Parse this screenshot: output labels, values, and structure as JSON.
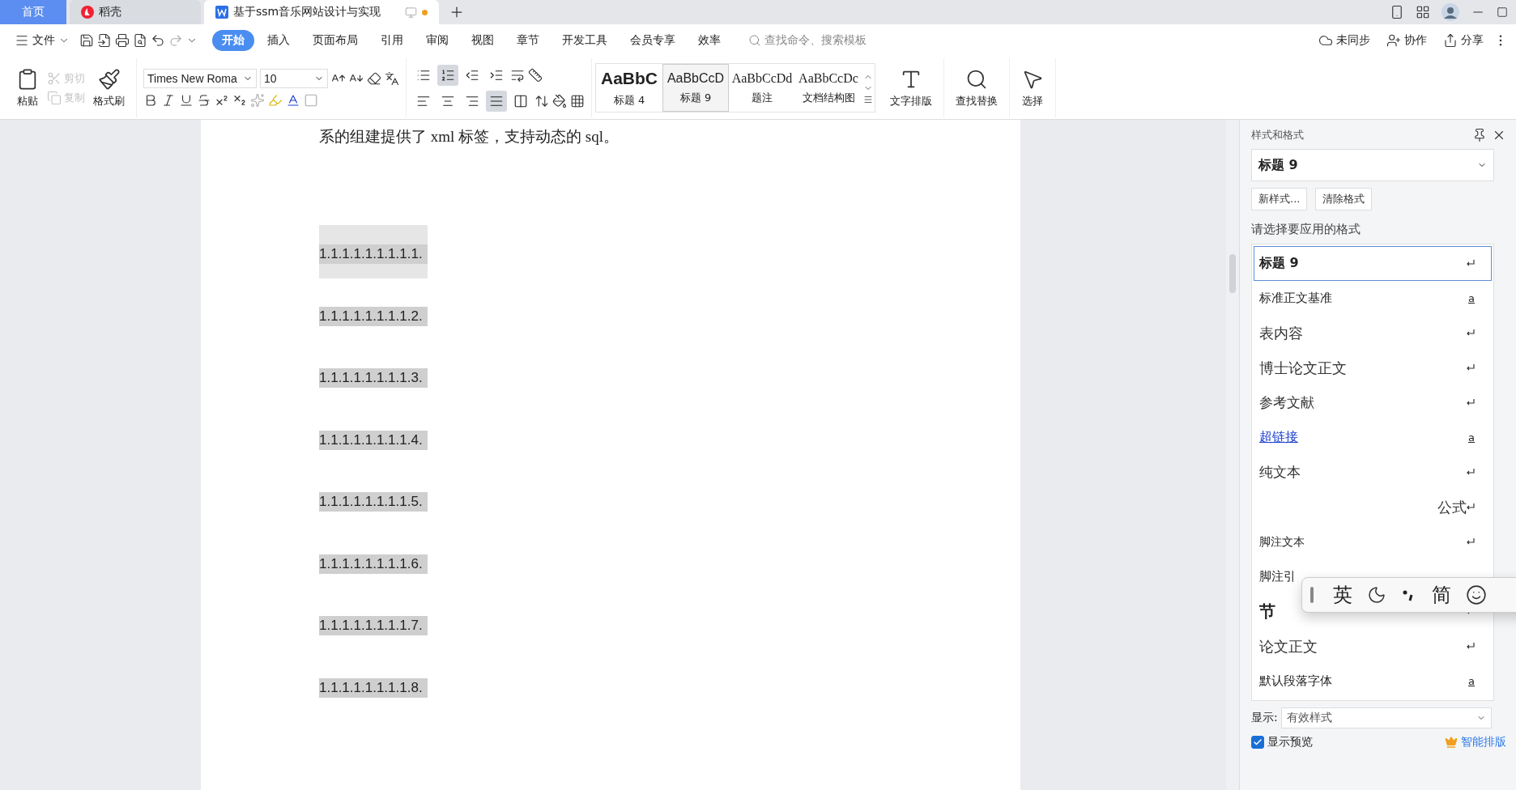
{
  "tabs": [
    {
      "label": "首页",
      "kind": "home",
      "selected": false
    },
    {
      "label": "稻壳",
      "kind": "app",
      "selected": false
    },
    {
      "label": "基于ssm音乐网站设计与实现",
      "kind": "doc",
      "selected": true,
      "unsaved": true
    }
  ],
  "menu": {
    "file": "文件",
    "ribbon_tabs": [
      {
        "label": "开始",
        "selected": true
      },
      {
        "label": "插入",
        "selected": false
      },
      {
        "label": "页面布局",
        "selected": false
      },
      {
        "label": "引用",
        "selected": false
      },
      {
        "label": "审阅",
        "selected": false
      },
      {
        "label": "视图",
        "selected": false
      },
      {
        "label": "章节",
        "selected": false
      },
      {
        "label": "开发工具",
        "selected": false
      },
      {
        "label": "会员专享",
        "selected": false
      },
      {
        "label": "效率",
        "selected": false
      }
    ],
    "search": {
      "placeholder": "查找命令、搜索模板"
    },
    "actions": [
      {
        "label": "未同步",
        "kind": "sync"
      },
      {
        "label": "协作",
        "kind": "collab"
      },
      {
        "label": "分享",
        "kind": "share"
      }
    ]
  },
  "ribbon": {
    "clipboard": [
      {
        "label": "粘贴",
        "kind": "paste"
      },
      {
        "label": "剪切",
        "kind": "cut",
        "disabled": true
      },
      {
        "label": "复制",
        "kind": "copy",
        "disabled": true
      },
      {
        "label": "格式刷",
        "kind": "brush"
      }
    ],
    "font": {
      "name": "Times New Roma",
      "size": "10"
    },
    "paragraph_tools": [
      {
        "kind": "bullets",
        "selected": false
      },
      {
        "kind": "numbering",
        "selected": true
      },
      {
        "kind": "outdent",
        "selected": false
      },
      {
        "kind": "indent",
        "selected": false
      }
    ],
    "align_tools": [
      {
        "kind": "left",
        "selected": false
      },
      {
        "kind": "center",
        "selected": false
      },
      {
        "kind": "right",
        "selected": false
      },
      {
        "kind": "justify",
        "selected": true
      },
      {
        "kind": "distribute",
        "selected": false
      }
    ],
    "styles": [
      {
        "preview": "AaBbC",
        "label": "标题 4",
        "kind": "heading",
        "selected": false
      },
      {
        "preview": "AaBbCcD",
        "label": "标题 9",
        "kind": "sans",
        "selected": true
      },
      {
        "preview": "AaBbCcDd",
        "label": "题注",
        "kind": "serif",
        "selected": false
      },
      {
        "preview": "AaBbCcDc",
        "label": "文档结构图",
        "kind": "serif",
        "selected": false
      }
    ],
    "big_buttons": [
      {
        "label": "文字排版",
        "kind": "layout"
      },
      {
        "label": "查找替换",
        "kind": "find"
      },
      {
        "label": "选择",
        "kind": "select"
      }
    ]
  },
  "document": {
    "intro": "系的组建提供了 xml 标签，支持动态的 sql。",
    "headings": [
      {
        "text": "1.1.1.1.1.1.1.1.1.",
        "selected": true
      },
      {
        "text": "1.1.1.1.1.1.1.1.2.",
        "selected": false
      },
      {
        "text": "1.1.1.1.1.1.1.1.3.",
        "selected": false
      },
      {
        "text": "1.1.1.1.1.1.1.1.4.",
        "selected": false
      },
      {
        "text": "1.1.1.1.1.1.1.1.5.",
        "selected": false
      },
      {
        "text": "1.1.1.1.1.1.1.1.6.",
        "selected": false
      },
      {
        "text": "1.1.1.1.1.1.1.1.7.",
        "selected": false
      },
      {
        "text": "1.1.1.1.1.1.1.1.8.",
        "selected": false
      }
    ]
  },
  "styles_panel": {
    "title": "样式和格式",
    "current": "标题  9",
    "buttons": [
      "新样式...",
      "清除格式"
    ],
    "prompt": "请选择要应用的格式",
    "items": [
      {
        "label": "标题  9",
        "kind": "boldpara",
        "selected": true
      },
      {
        "label": "标准正文基准",
        "kind": "sanschar",
        "mark": "a",
        "selected": false
      },
      {
        "label": "表内容",
        "kind": "bigserifpara",
        "selected": false
      },
      {
        "label": "博士论文正文",
        "kind": "bigserifpara",
        "selected": false
      },
      {
        "label": "参考文献",
        "kind": "serifpara",
        "selected": false
      },
      {
        "label": "超链接",
        "kind": "linkchar",
        "mark": "a",
        "selected": false
      },
      {
        "label": "纯文本",
        "kind": "serifpara",
        "selected": false
      },
      {
        "label": "公式",
        "kind": "rightserifpara",
        "selected": false
      },
      {
        "label": "脚注文本",
        "kind": "smallpara",
        "selected": false
      },
      {
        "label": "脚注引",
        "kind": "sanscovered",
        "selected": false
      },
      {
        "label": "节",
        "kind": "heavypara",
        "selected": false
      },
      {
        "label": "论文正文",
        "kind": "bigserifpara",
        "selected": false
      },
      {
        "label": "默认段落字体",
        "kind": "sanschar",
        "mark": "a",
        "selected": false
      }
    ],
    "show_label": "显示:",
    "show_value": "有效样式",
    "preview": {
      "label": "显示预览",
      "checked": true
    },
    "smart": "智能排版"
  },
  "ime": {
    "mode": "英",
    "script": "简"
  }
}
